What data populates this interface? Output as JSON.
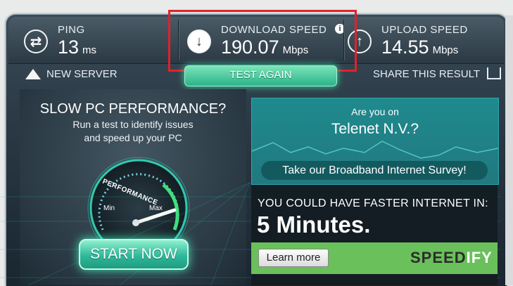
{
  "metrics": {
    "ping": {
      "label": "PING",
      "value": "13",
      "unit": "ms"
    },
    "download": {
      "label": "DOWNLOAD SPEED",
      "value": "190.07",
      "unit": "Mbps"
    },
    "upload": {
      "label": "UPLOAD SPEED",
      "value": "14.55",
      "unit": "Mbps"
    }
  },
  "actions": {
    "new_server": "NEW SERVER",
    "test_again": "TEST AGAIN",
    "share": "SHARE THIS RESULT"
  },
  "promo_left": {
    "title": "SLOW PC PERFORMANCE?",
    "line1": "Run a test to identify issues",
    "line2": "and speed up your PC",
    "gauge_label": "PERFORMANCE",
    "gauge_min": "Min",
    "gauge_max": "Max",
    "start_button": "START NOW"
  },
  "survey": {
    "question_line1": "Are you on",
    "isp": "Telenet N.V.?",
    "button": "Take our Broadband Internet Survey!"
  },
  "ad": {
    "headline": "YOU COULD HAVE FASTER INTERNET IN:",
    "time": "5 Minutes.",
    "learn_more": "Learn more",
    "brand_part1": "SPEED",
    "brand_part2": "IFY"
  },
  "colors": {
    "accent_green": "#2bb38a",
    "highlight_red": "#e2212a",
    "teal_panel": "#20797f",
    "ad_green": "#6ac05a"
  }
}
